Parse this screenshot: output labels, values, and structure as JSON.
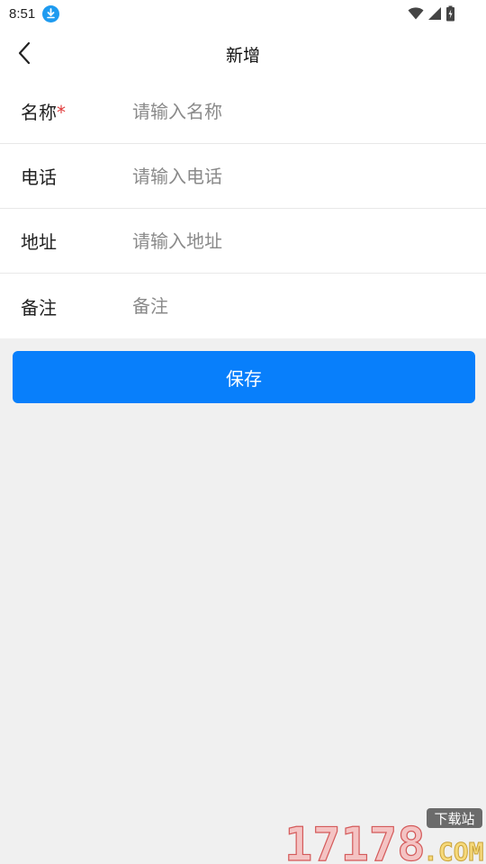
{
  "status_bar": {
    "time": "8:51",
    "icons": [
      "download-badge-icon",
      "wifi-icon",
      "cellular-signal-icon",
      "battery-charging-icon"
    ]
  },
  "header": {
    "title": "新增",
    "back_icon": "chevron-left-icon"
  },
  "form": {
    "fields": [
      {
        "label": "名称",
        "required_mark": "*",
        "placeholder": "请输入名称",
        "value": ""
      },
      {
        "label": "电话",
        "placeholder": "请输入电话",
        "value": ""
      },
      {
        "label": "地址",
        "placeholder": "请输入地址",
        "value": ""
      },
      {
        "label": "备注",
        "placeholder": "备注",
        "value": ""
      }
    ]
  },
  "actions": {
    "save_label": "保存"
  },
  "watermark": {
    "brand": "17178",
    "suffix": ".COM",
    "tag": "下载站"
  },
  "colors": {
    "primary": "#087ffb",
    "required": "#e03c3c",
    "page_bg": "#f0f0f0",
    "status_badge": "#1e9bf0"
  }
}
